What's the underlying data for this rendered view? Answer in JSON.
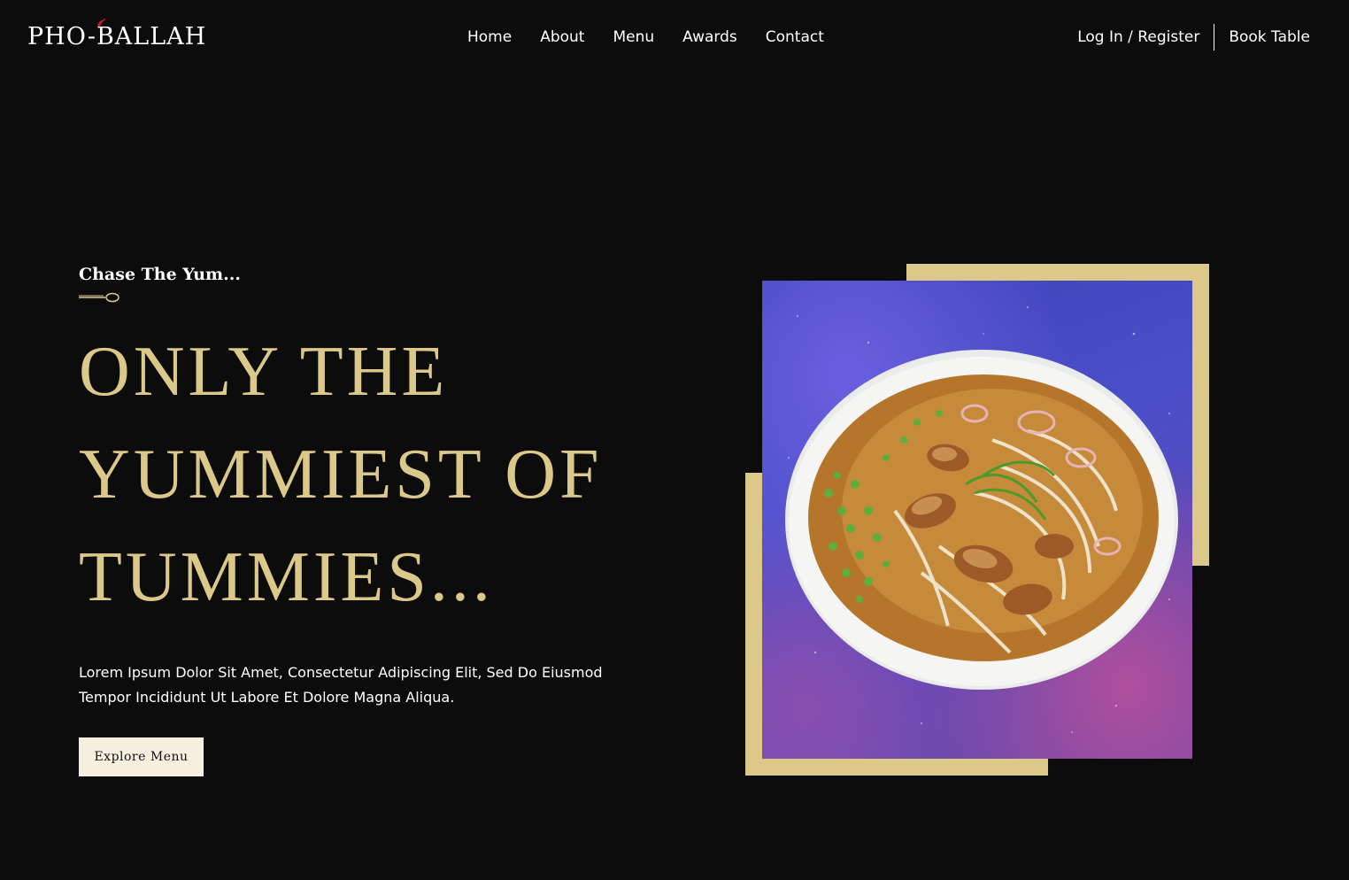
{
  "brand": {
    "name": "PHO-BALLAH"
  },
  "nav": {
    "items": [
      {
        "label": "Home"
      },
      {
        "label": "About"
      },
      {
        "label": "Menu"
      },
      {
        "label": "Awards"
      },
      {
        "label": "Contact"
      }
    ]
  },
  "auth": {
    "login_label": "Log In / Register",
    "book_label": "Book Table"
  },
  "hero": {
    "eyebrow": "Chase The Yum...",
    "headline": [
      "ONLY THE",
      "YUMMIEST OF",
      "TUMMIES..."
    ],
    "description_line1": "Lorem Ipsum Dolor Sit Amet, Consectetur Adipiscing Elit, Sed Do Eiusmod",
    "description_line2": "Tempor Incididunt Ut Labore Et Dolore Magna Aliqua.",
    "cta_label": "Explore Menu"
  },
  "colors": {
    "background": "#0c0c0c",
    "accent_gold": "#dcc98a",
    "cta_bg": "#f7efdf",
    "photo_bg": "#4a4fc9"
  },
  "icons": {
    "logo_mark": "chili-icon",
    "divider": "spoon-icon"
  }
}
